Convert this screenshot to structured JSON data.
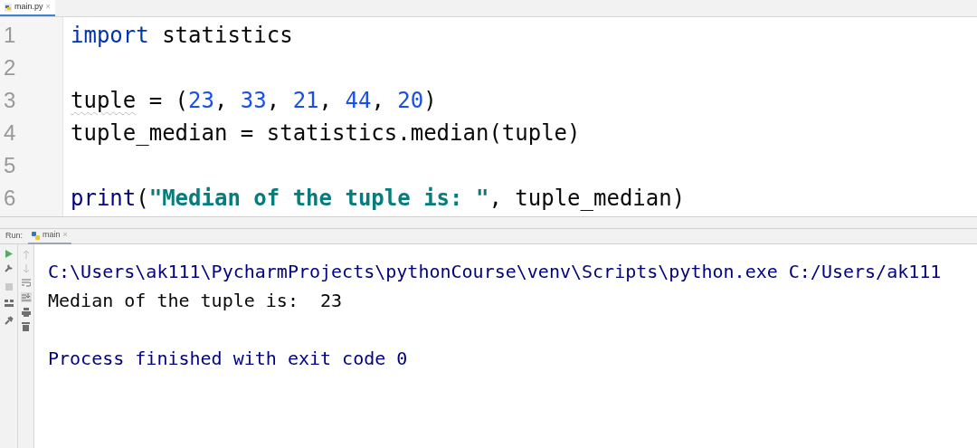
{
  "editor_tabs": [
    {
      "label": "main.py",
      "selected": true,
      "close": "×"
    }
  ],
  "code_lines": [
    {
      "number": "1",
      "tokens": [
        {
          "kind": "keyword",
          "text": "import"
        },
        {
          "kind": "plain",
          "text": " statistics"
        }
      ]
    },
    {
      "number": "2"
    },
    {
      "number": "3",
      "tokens": [
        {
          "kind": "warning",
          "text": "tuple"
        },
        {
          "kind": "plain",
          "text": " = ("
        },
        {
          "kind": "number",
          "text": "23"
        },
        {
          "kind": "plain",
          "text": ", "
        },
        {
          "kind": "number",
          "text": "33"
        },
        {
          "kind": "plain",
          "text": ", "
        },
        {
          "kind": "number",
          "text": "21"
        },
        {
          "kind": "plain",
          "text": ", "
        },
        {
          "kind": "number",
          "text": "44"
        },
        {
          "kind": "plain",
          "text": ", "
        },
        {
          "kind": "number",
          "text": "20"
        },
        {
          "kind": "plain",
          "text": ")"
        }
      ]
    },
    {
      "number": "4",
      "tokens": [
        {
          "kind": "plain",
          "text": "tuple_median = statistics.median(tuple)"
        }
      ]
    },
    {
      "number": "5"
    },
    {
      "number": "6",
      "tokens": [
        {
          "kind": "builtin",
          "text": "print"
        },
        {
          "kind": "plain",
          "text": "("
        },
        {
          "kind": "string",
          "text": "\"Median of the tuple is: \""
        },
        {
          "kind": "plain",
          "text": ", tuple_median)"
        }
      ]
    }
  ],
  "run_panel": {
    "label": "Run:",
    "tabs": [
      {
        "label": "main",
        "selected": true,
        "close": "×"
      }
    ],
    "output": [
      {
        "kind": "system",
        "text": "C:\\Users\\ak111\\PycharmProjects\\pythonCourse\\venv\\Scripts\\python.exe C:/Users/ak111"
      },
      {
        "kind": "stdout",
        "text": "Median of the tuple is:  23"
      },
      {
        "kind": "blank"
      },
      {
        "kind": "system",
        "text": "Process finished with exit code 0"
      }
    ]
  }
}
